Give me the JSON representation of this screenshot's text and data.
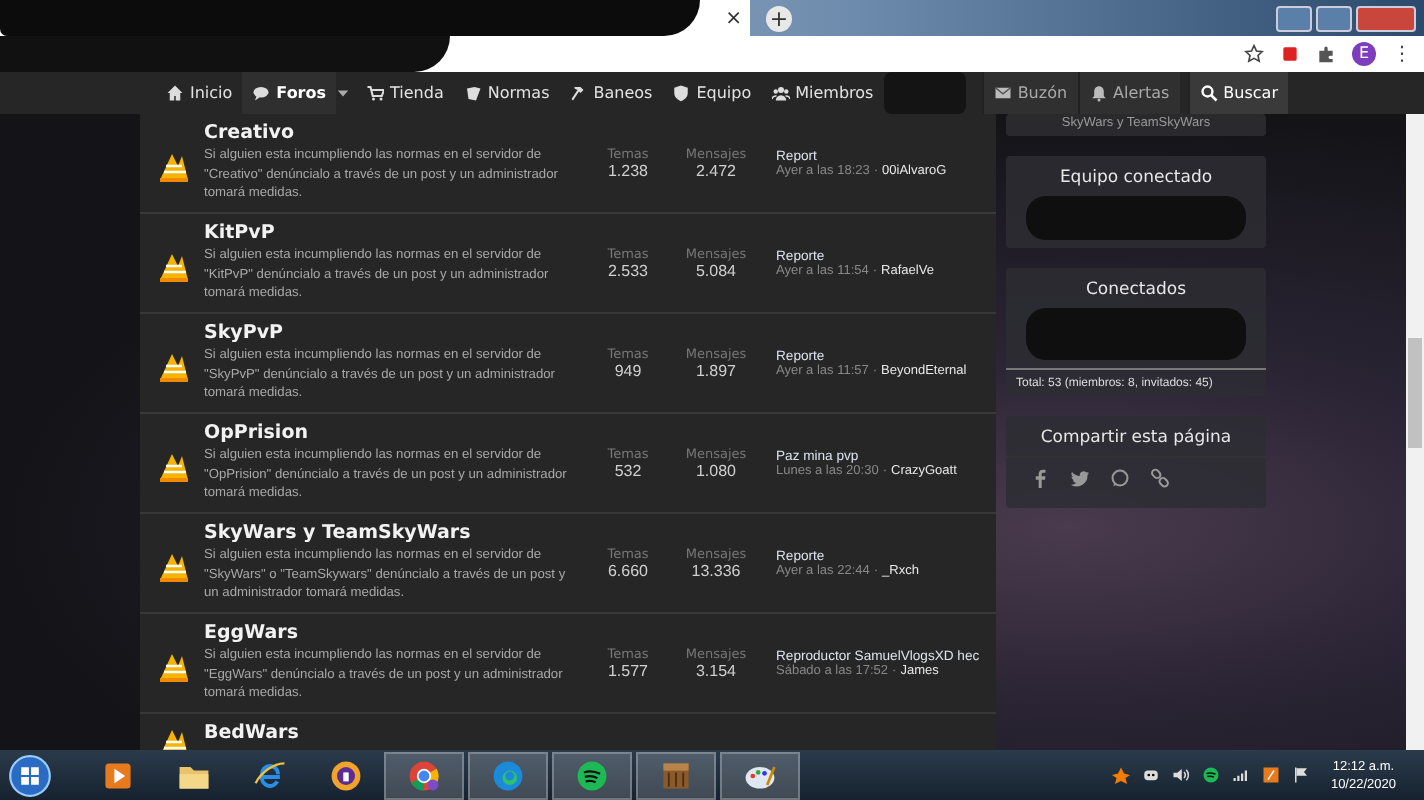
{
  "browser": {
    "tab_close": "×",
    "new_tab": "+",
    "profile_initial": "E",
    "menu": "⋮"
  },
  "nav": {
    "items": [
      {
        "label": "Inicio",
        "selected": false
      },
      {
        "label": "Foros",
        "selected": true
      },
      {
        "label": "Tienda",
        "selected": false
      },
      {
        "label": "Normas",
        "selected": false
      },
      {
        "label": "Baneos",
        "selected": false
      },
      {
        "label": "Equipo",
        "selected": false
      },
      {
        "label": "Miembros",
        "selected": false
      }
    ],
    "right": [
      {
        "label": "Buzón",
        "kind": "mail"
      },
      {
        "label": "Alertas",
        "kind": "bell"
      },
      {
        "label": "Buscar",
        "kind": "search"
      }
    ]
  },
  "forums": [
    {
      "title": "Creativo",
      "description": "Si alguien esta incumpliendo las normas en el servidor de \"Creativo\" denúncialo a través de un post y un administrador tomará medidas.",
      "stats": [
        {
          "label": "Temas",
          "value": "1.238"
        },
        {
          "label": "Mensajes",
          "value": "2.472"
        }
      ],
      "latest": {
        "title": "Report",
        "time": "Ayer a las 18:23",
        "separator": "·",
        "user": "00iAlvaroG"
      }
    },
    {
      "title": "KitPvP",
      "description": "Si alguien esta incumpliendo las normas en el servidor de \"KitPvP\" denúncialo a través de un post y un administrador tomará medidas.",
      "stats": [
        {
          "label": "Temas",
          "value": "2.533"
        },
        {
          "label": "Mensajes",
          "value": "5.084"
        }
      ],
      "latest": {
        "title": "Reporte",
        "time": "Ayer a las 11:54",
        "separator": "·",
        "user": "RafaelVe"
      }
    },
    {
      "title": "SkyPvP",
      "description": "Si alguien esta incumpliendo las normas en el servidor de \"SkyPvP\" denúncialo a través de un post y un administrador tomará medidas.",
      "stats": [
        {
          "label": "Temas",
          "value": "949"
        },
        {
          "label": "Mensajes",
          "value": "1.897"
        }
      ],
      "latest": {
        "title": "Reporte",
        "time": "Ayer a las 11:57",
        "separator": "·",
        "user": "BeyondEternal"
      }
    },
    {
      "title": "OpPrision",
      "description": "Si alguien esta incumpliendo las normas en el servidor de \"OpPrision\" denúncialo a través de un post y un administrador tomará medidas.",
      "stats": [
        {
          "label": "Temas",
          "value": "532"
        },
        {
          "label": "Mensajes",
          "value": "1.080"
        }
      ],
      "latest": {
        "title": "Paz mina pvp",
        "time": "Lunes a las 20:30",
        "separator": "·",
        "user": "CrazyGoatt"
      }
    },
    {
      "title": "SkyWars y TeamSkyWars",
      "description": "Si alguien esta incumpliendo las normas en el servidor de \"SkyWars\" o \"TeamSkywars\" denúncialo a través de un post y un administrador tomará medidas.",
      "stats": [
        {
          "label": "Temas",
          "value": "6.660"
        },
        {
          "label": "Mensajes",
          "value": "13.336"
        }
      ],
      "latest": {
        "title": "Reporte",
        "time": "Ayer a las 22:44",
        "separator": "·",
        "user": "_Rxch"
      }
    },
    {
      "title": "EggWars",
      "description": "Si alguien esta incumpliendo las normas en el servidor de \"EggWars\" denúncialo a través de un post y un administrador tomará medidas.",
      "stats": [
        {
          "label": "Temas",
          "value": "1.577"
        },
        {
          "label": "Mensajes",
          "value": "3.154"
        }
      ],
      "latest": {
        "title": "Reproductor SamuelVlogsXD hec",
        "time": "Sábado a las 17:52",
        "separator": "·",
        "user": "James"
      }
    },
    {
      "title": "BedWars"
    }
  ],
  "sidebar": {
    "partial_card": "SkyWars y TeamSkyWars",
    "cards": [
      {
        "kind": "team",
        "title": "Equipo conectado"
      },
      {
        "kind": "online",
        "title": "Conectados",
        "footer": "Total: 53 (miembros: 8, invitados: 45)"
      },
      {
        "kind": "share",
        "title": "Compartir esta página"
      }
    ]
  },
  "taskbar": {
    "time": "12:12 a.m.",
    "date": "10/22/2020"
  }
}
